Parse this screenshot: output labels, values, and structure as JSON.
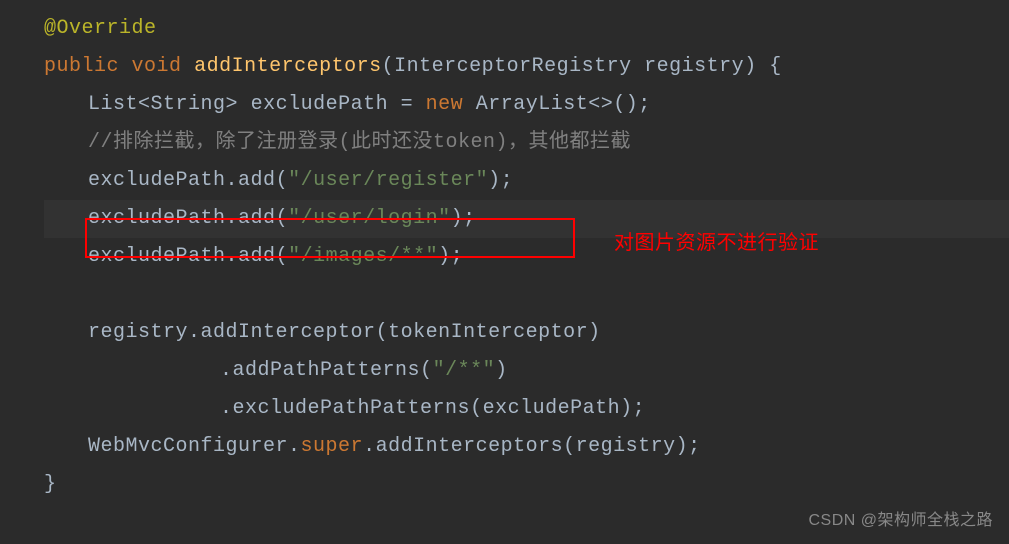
{
  "code": {
    "annotation": "@Override",
    "kw_public": "public",
    "kw_void": "void",
    "kw_new": "new",
    "kw_super": "super",
    "method_name": "addInterceptors",
    "param_type": "InterceptorRegistry",
    "param_name": "registry",
    "list_type": "List",
    "string_type": "String",
    "var_excludePath": "excludePath",
    "arraylist": "ArrayList",
    "comment_line": "//排除拦截，除了注册登录(此时还没token)，其他都拦截",
    "add_method": "add",
    "str_register": "\"/user/register\"",
    "str_login": "\"/user/login\"",
    "str_images": "\"/images/**\"",
    "var_registry": "registry",
    "addInterceptor": "addInterceptor",
    "tokenInterceptor": "tokenInterceptor",
    "addPathPatterns": "addPathPatterns",
    "str_allpaths": "\"/**\"",
    "excludePathPatterns": "excludePathPatterns",
    "webMvcConfigurer": "WebMvcConfigurer",
    "addInterceptors2": "addInterceptors"
  },
  "annotation_label": "对图片资源不进行验证",
  "watermark": "CSDN @架构师全栈之路"
}
